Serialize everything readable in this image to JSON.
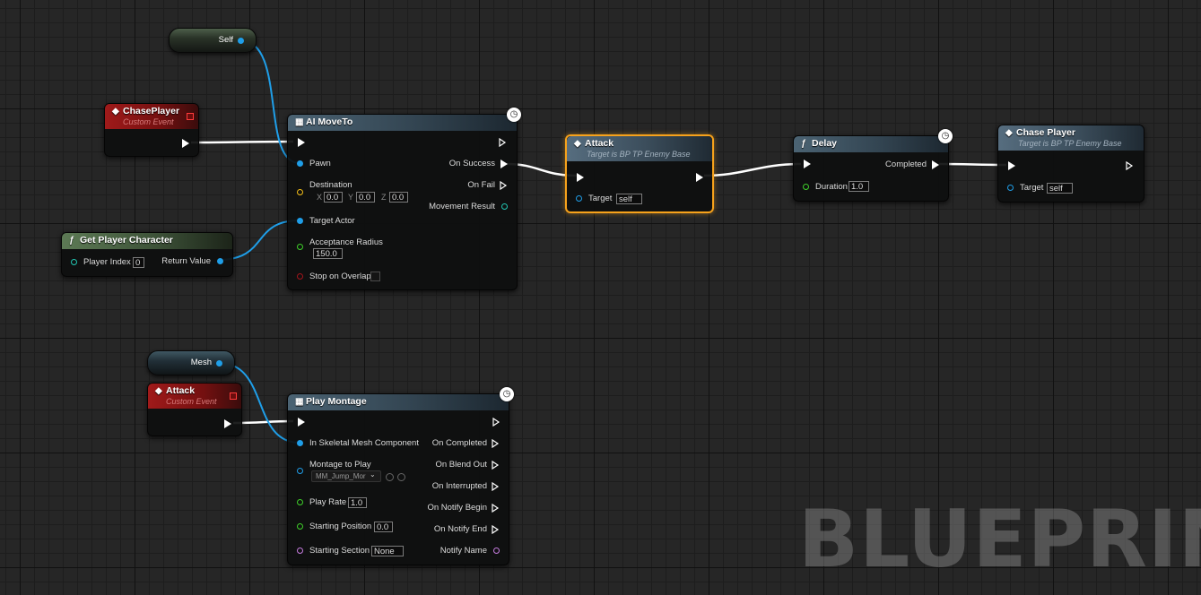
{
  "graph": {
    "watermark": "BLUEPRINT",
    "self_node": {
      "label": "Self"
    },
    "mesh_node": {
      "label": "Mesh"
    },
    "chase_event": {
      "title": "ChasePlayer",
      "subtitle": "Custom Event"
    },
    "attack_event": {
      "title": "Attack",
      "subtitle": "Custom Event"
    },
    "get_player": {
      "title": "Get Player Character",
      "player_index_label": "Player Index",
      "player_index_value": "0",
      "return_label": "Return Value"
    },
    "ai_move_to": {
      "title": "AI MoveTo",
      "pawn": "Pawn",
      "destination": "Destination",
      "dest_x_label": "X",
      "dest_x": "0.0",
      "dest_y_label": "Y",
      "dest_y": "0.0",
      "dest_z_label": "Z",
      "dest_z": "0.0",
      "target_actor": "Target Actor",
      "acceptance_radius": "Acceptance Radius",
      "acceptance_value": "150.0",
      "stop_on_overlap": "Stop on Overlap",
      "on_success": "On Success",
      "on_fail": "On Fail",
      "movement_result": "Movement Result"
    },
    "attack_call": {
      "title": "Attack",
      "subtitle": "Target is BP TP Enemy Base",
      "target_label": "Target",
      "target_value": "self"
    },
    "delay": {
      "title": "Delay",
      "duration_label": "Duration",
      "duration_value": "1.0",
      "completed": "Completed"
    },
    "chase_call": {
      "title": "Chase Player",
      "subtitle": "Target is BP TP Enemy Base",
      "target_label": "Target",
      "target_value": "self"
    },
    "play_montage": {
      "title": "Play Montage",
      "in_mesh": "In Skeletal Mesh Component",
      "montage_to_play": "Montage to Play",
      "montage_value": "MM_Jump_Mor",
      "play_rate": "Play Rate",
      "play_rate_value": "1.0",
      "starting_position": "Starting Position",
      "starting_position_value": "0.0",
      "starting_section": "Starting Section",
      "starting_section_value": "None",
      "on_completed": "On Completed",
      "on_blend_out": "On Blend Out",
      "on_interrupted": "On Interrupted",
      "on_notify_begin": "On Notify Begin",
      "on_notify_end": "On Notify End",
      "notify_name": "Notify Name"
    }
  },
  "colors": {
    "object_pin": "#1f9ee8",
    "vector_pin": "#f5c018",
    "float_pin": "#3fd12a",
    "bool_pin": "#a3151c",
    "name_pin": "#c77ce0",
    "teal_pin": "#22c7b3",
    "selection": "#f7a21b"
  }
}
